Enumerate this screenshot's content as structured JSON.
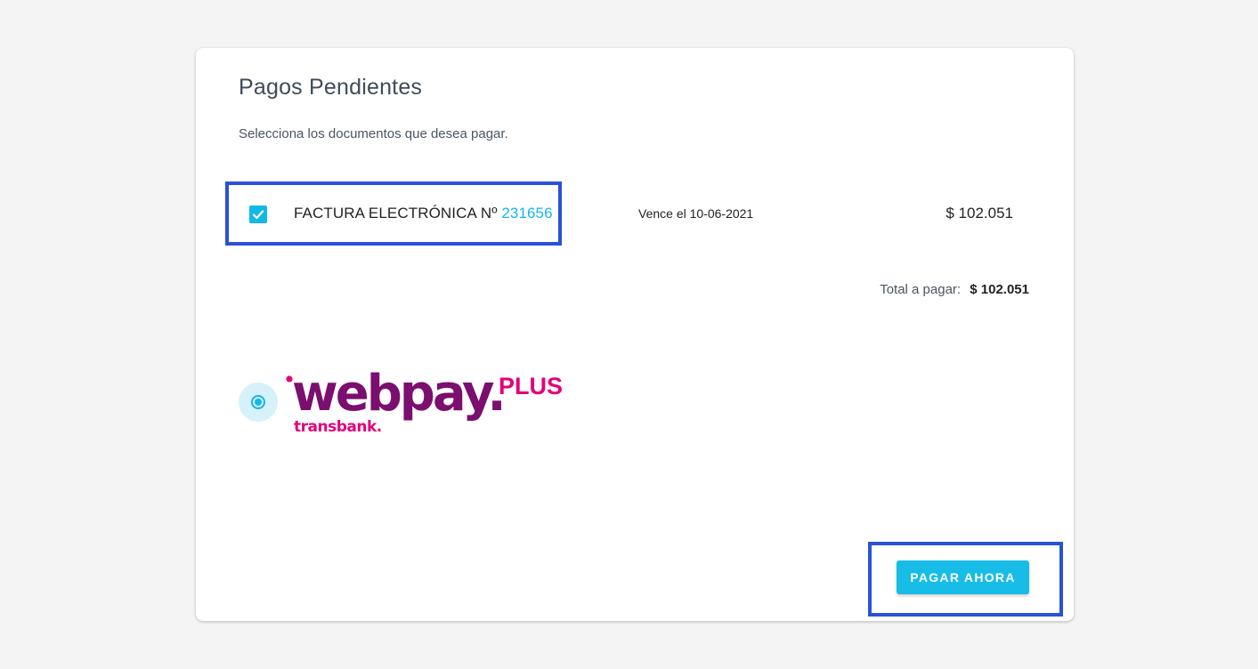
{
  "page": {
    "title": "Pagos Pendientes",
    "subtitle": "Selecciona los documentos que desea pagar."
  },
  "documents": [
    {
      "checked": true,
      "label": "FACTURA ELECTRÓNICA Nº",
      "number": "231656",
      "due": "Vence el 10-06-2021",
      "amount": "$ 102.051"
    }
  ],
  "total": {
    "label": "Total a pagar:",
    "value": "$ 102.051"
  },
  "payment_method": {
    "selected": true,
    "logo_text": "webpay.",
    "logo_plus": "PLUS",
    "logo_sub": "transbank."
  },
  "actions": {
    "pay_label": "PAGAR AHORA"
  },
  "colors": {
    "accent": "#17bde6",
    "highlight": "#2952d6",
    "webpay_purple": "#7b0e6e",
    "webpay_pink": "#e3007b"
  }
}
